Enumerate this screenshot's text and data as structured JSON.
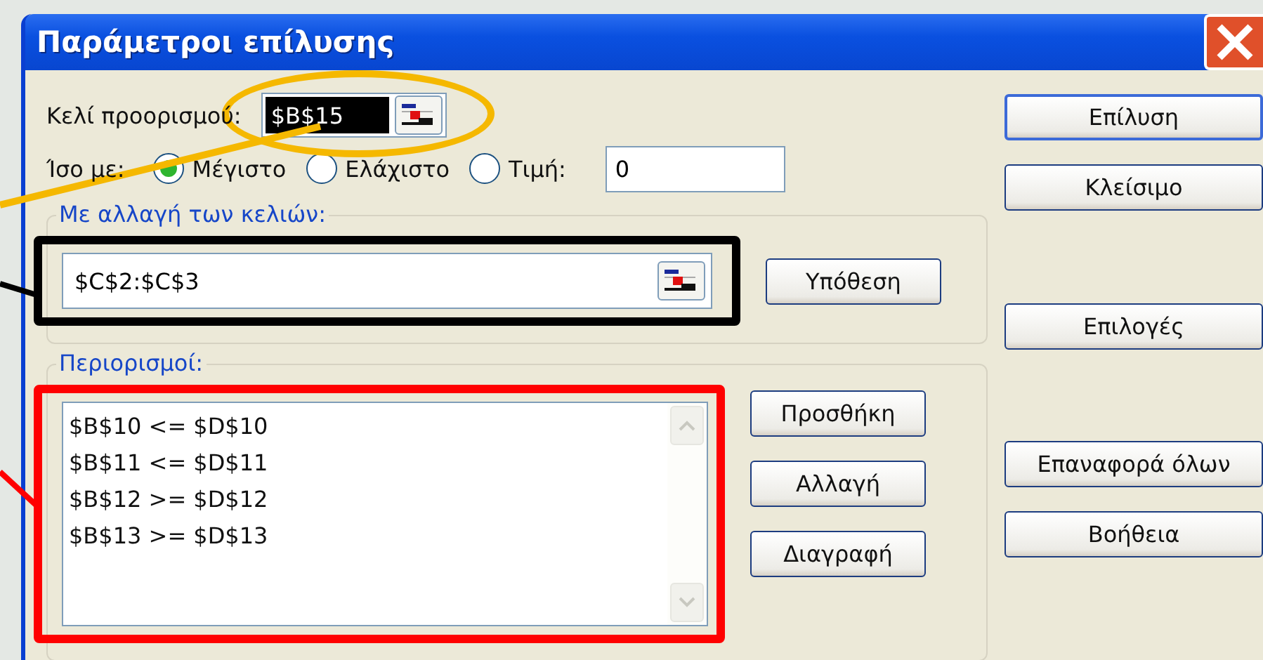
{
  "window": {
    "title": "Παράμετροι επίλυσης"
  },
  "target_cell": {
    "label": "Κελί προορισμού:",
    "value": "$B$15"
  },
  "equal_to": {
    "label": "Ίσο με:",
    "options": [
      {
        "label": "Μέγιστο",
        "selected": true
      },
      {
        "label": "Ελάχιστο",
        "selected": false
      },
      {
        "label": "Τιμή:",
        "selected": false
      }
    ],
    "value": "0"
  },
  "changing_cells": {
    "label": "Με αλλαγή των κελιών:",
    "value": "$C$2:$C$3",
    "button": "Υπόθεση"
  },
  "constraints": {
    "label": "Περιορισμοί:",
    "items": [
      "$B$10 <= $D$10",
      "$B$11 <= $D$11",
      "$B$12 >= $D$12",
      "$B$13 >= $D$13"
    ],
    "buttons": [
      "Προσθήκη",
      "Αλλαγή",
      "Διαγραφή"
    ]
  },
  "side_buttons": [
    [
      {
        "label": "Επίλυση",
        "default": true
      },
      {
        "label": "Κλείσιμο",
        "default": false
      }
    ],
    [
      {
        "label": "Επιλογές",
        "default": false
      }
    ],
    [
      {
        "label": "Επαναφορά όλων",
        "default": false
      },
      {
        "label": "Βοήθεια",
        "default": false
      }
    ]
  ]
}
